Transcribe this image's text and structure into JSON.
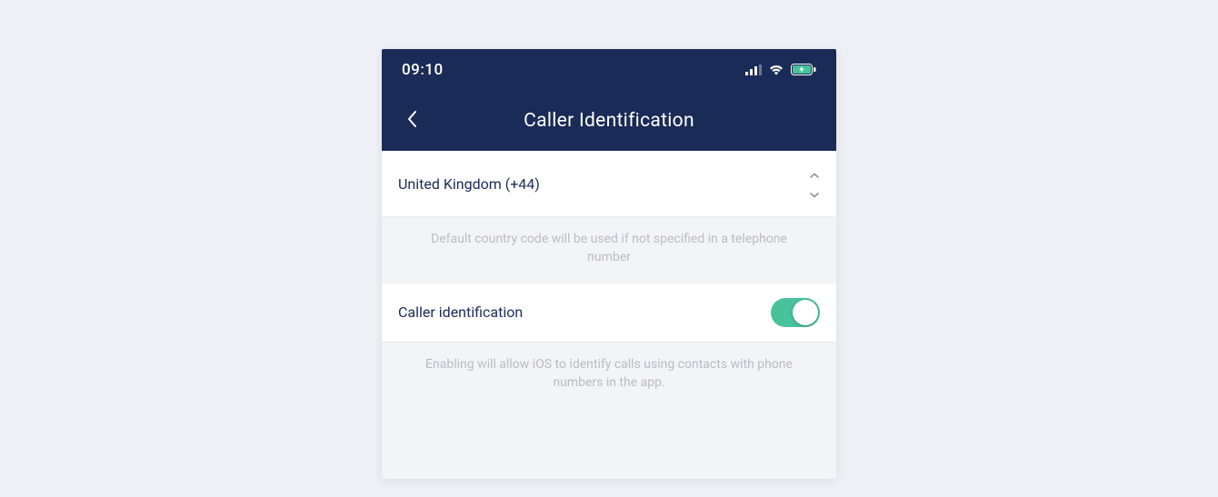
{
  "statusBar": {
    "time": "09:10"
  },
  "nav": {
    "title": "Caller Identification"
  },
  "countryRow": {
    "label": "United Kingdom (+44)",
    "helper": "Default country code will be used if not specified in a telephone number"
  },
  "callerIdRow": {
    "label": "Caller identification",
    "helper": "Enabling will allow iOS to identify calls using contacts with phone numbers in the app."
  }
}
